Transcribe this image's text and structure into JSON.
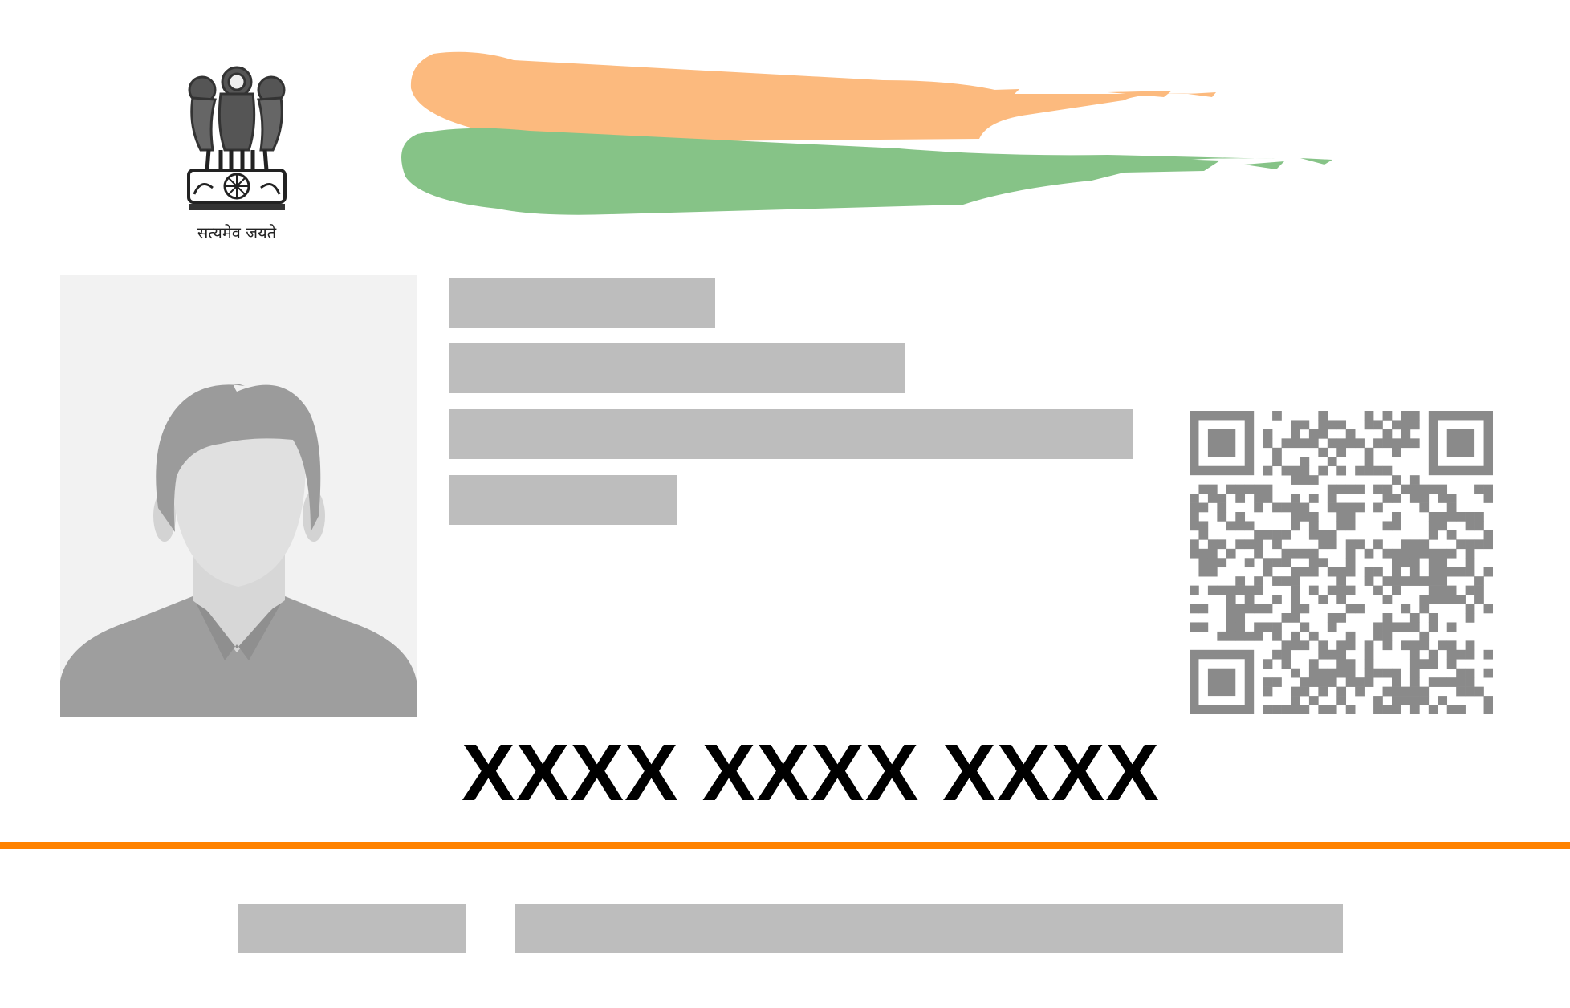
{
  "card": {
    "motto": "सत्यमेव जयते",
    "number": "XXXX XXXX XXXX"
  },
  "colors": {
    "saffron": "#fcba7e",
    "green": "#86c387",
    "divider": "#ff8200",
    "redaction": "#bdbdbd",
    "qr": "#8a8a8a"
  },
  "icons": {
    "emblem": "national-emblem-icon",
    "photo": "person-placeholder-icon",
    "qr": "qr-code-icon"
  }
}
